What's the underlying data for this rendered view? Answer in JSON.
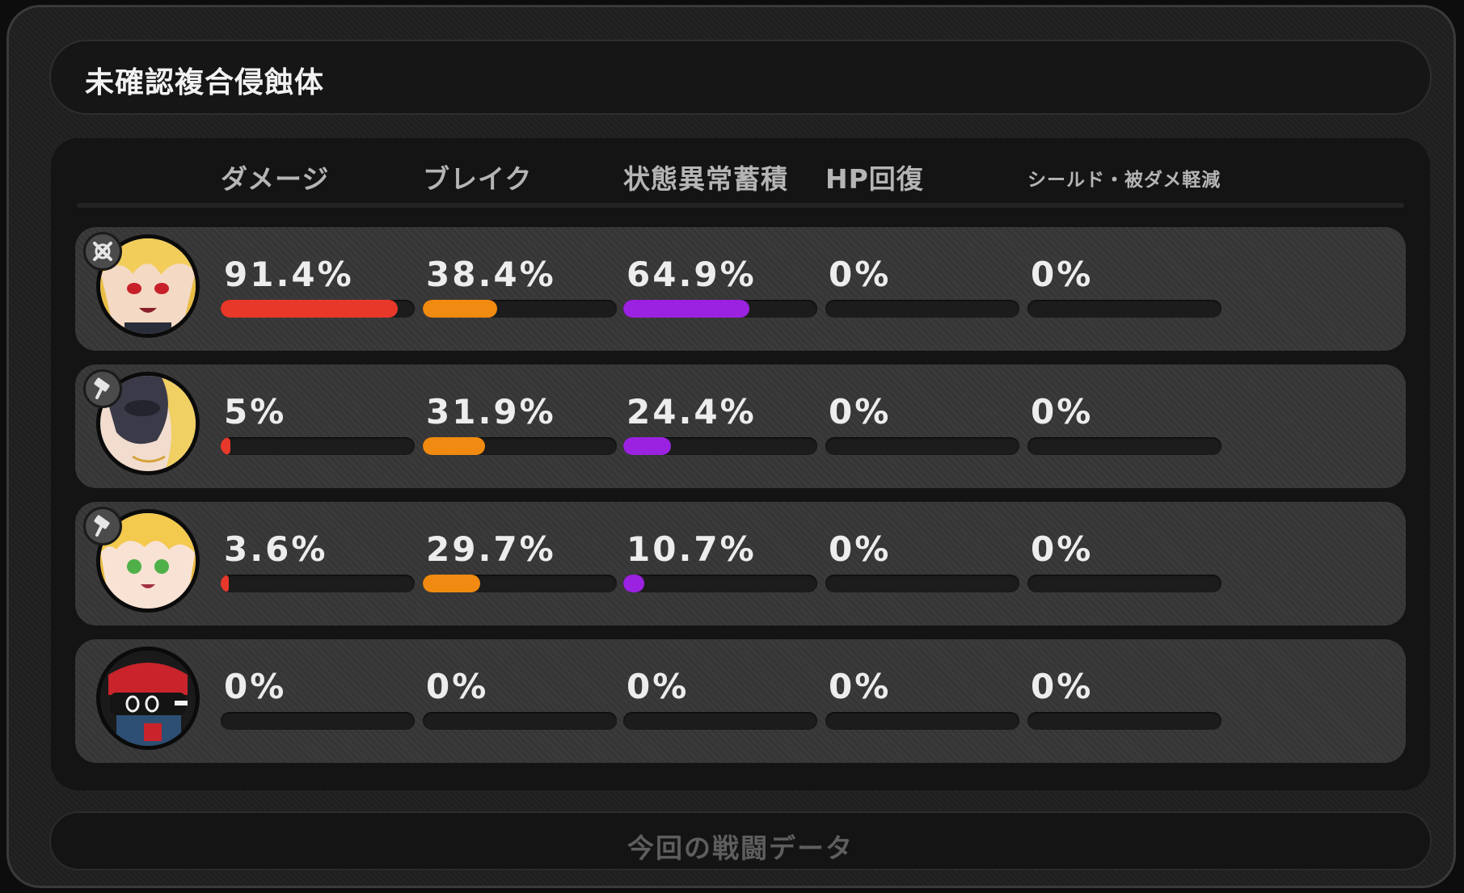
{
  "header": {
    "title": "未確認複合侵蝕体"
  },
  "columns": [
    {
      "label": "ダメージ",
      "color": "#e8382a"
    },
    {
      "label": "ブレイク",
      "color": "#f08a10"
    },
    {
      "label": "状態異常蓄積",
      "color": "#9a22e0"
    },
    {
      "label": "HP回復",
      "color": "#2fbf6a"
    },
    {
      "label": "シールド・被ダメ軽減",
      "color": "#3a8fe0"
    }
  ],
  "rows": [
    {
      "avatar": "blonde-girl-red-eyes",
      "badge": "crossed-swords-icon",
      "values": [
        {
          "text": "91.4%",
          "value": 91.4
        },
        {
          "text": "38.4%",
          "value": 38.4
        },
        {
          "text": "64.9%",
          "value": 64.9
        },
        {
          "text": "0%",
          "value": 0
        },
        {
          "text": "0%",
          "value": 0
        }
      ]
    },
    {
      "avatar": "masked-blonde-character",
      "badge": "hammer-icon",
      "values": [
        {
          "text": "5%",
          "value": 5
        },
        {
          "text": "31.9%",
          "value": 31.9
        },
        {
          "text": "24.4%",
          "value": 24.4
        },
        {
          "text": "0%",
          "value": 0
        },
        {
          "text": "0%",
          "value": 0
        }
      ]
    },
    {
      "avatar": "blonde-girl-green-eyes",
      "badge": "hammer-icon",
      "values": [
        {
          "text": "3.6%",
          "value": 3.6
        },
        {
          "text": "29.7%",
          "value": 29.7
        },
        {
          "text": "10.7%",
          "value": 10.7
        },
        {
          "text": "0%",
          "value": 0
        },
        {
          "text": "0%",
          "value": 0
        }
      ]
    },
    {
      "avatar": "red-cap-bangboo",
      "badge": "",
      "values": [
        {
          "text": "0%",
          "value": 0
        },
        {
          "text": "0%",
          "value": 0
        },
        {
          "text": "0%",
          "value": 0
        },
        {
          "text": "0%",
          "value": 0
        },
        {
          "text": "0%",
          "value": 0
        }
      ]
    }
  ],
  "footer": {
    "label": "今回の戦闘データ"
  }
}
